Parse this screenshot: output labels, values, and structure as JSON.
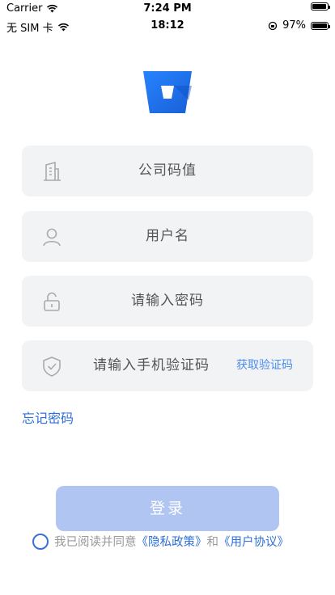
{
  "status_bar_outer": {
    "carrier": "Carrier",
    "time": "7:24 PM"
  },
  "status_bar_inner": {
    "carrier": "无 SIM 卡",
    "time": "18:12",
    "battery_text": "97%",
    "battery_level": 0.97
  },
  "logo": {
    "icon": "bitbucket-logo-icon",
    "color": "#2684ff"
  },
  "form": {
    "company_placeholder": "公司码值",
    "username_placeholder": "用户名",
    "password_placeholder": "请输入密码",
    "sms_placeholder": "请输入手机验证码",
    "get_code_label": "获取验证码"
  },
  "forgot_password": "忘记密码",
  "login_button": "登录",
  "agreement": {
    "prefix": "我已阅读并同意",
    "privacy": "《隐私政策》",
    "and": "和",
    "user_agreement": "《用户协议》"
  },
  "colors": {
    "accent": "#2e6fd9",
    "button_disabled": "#b0c5f2",
    "field_bg": "#f2f3f5"
  }
}
